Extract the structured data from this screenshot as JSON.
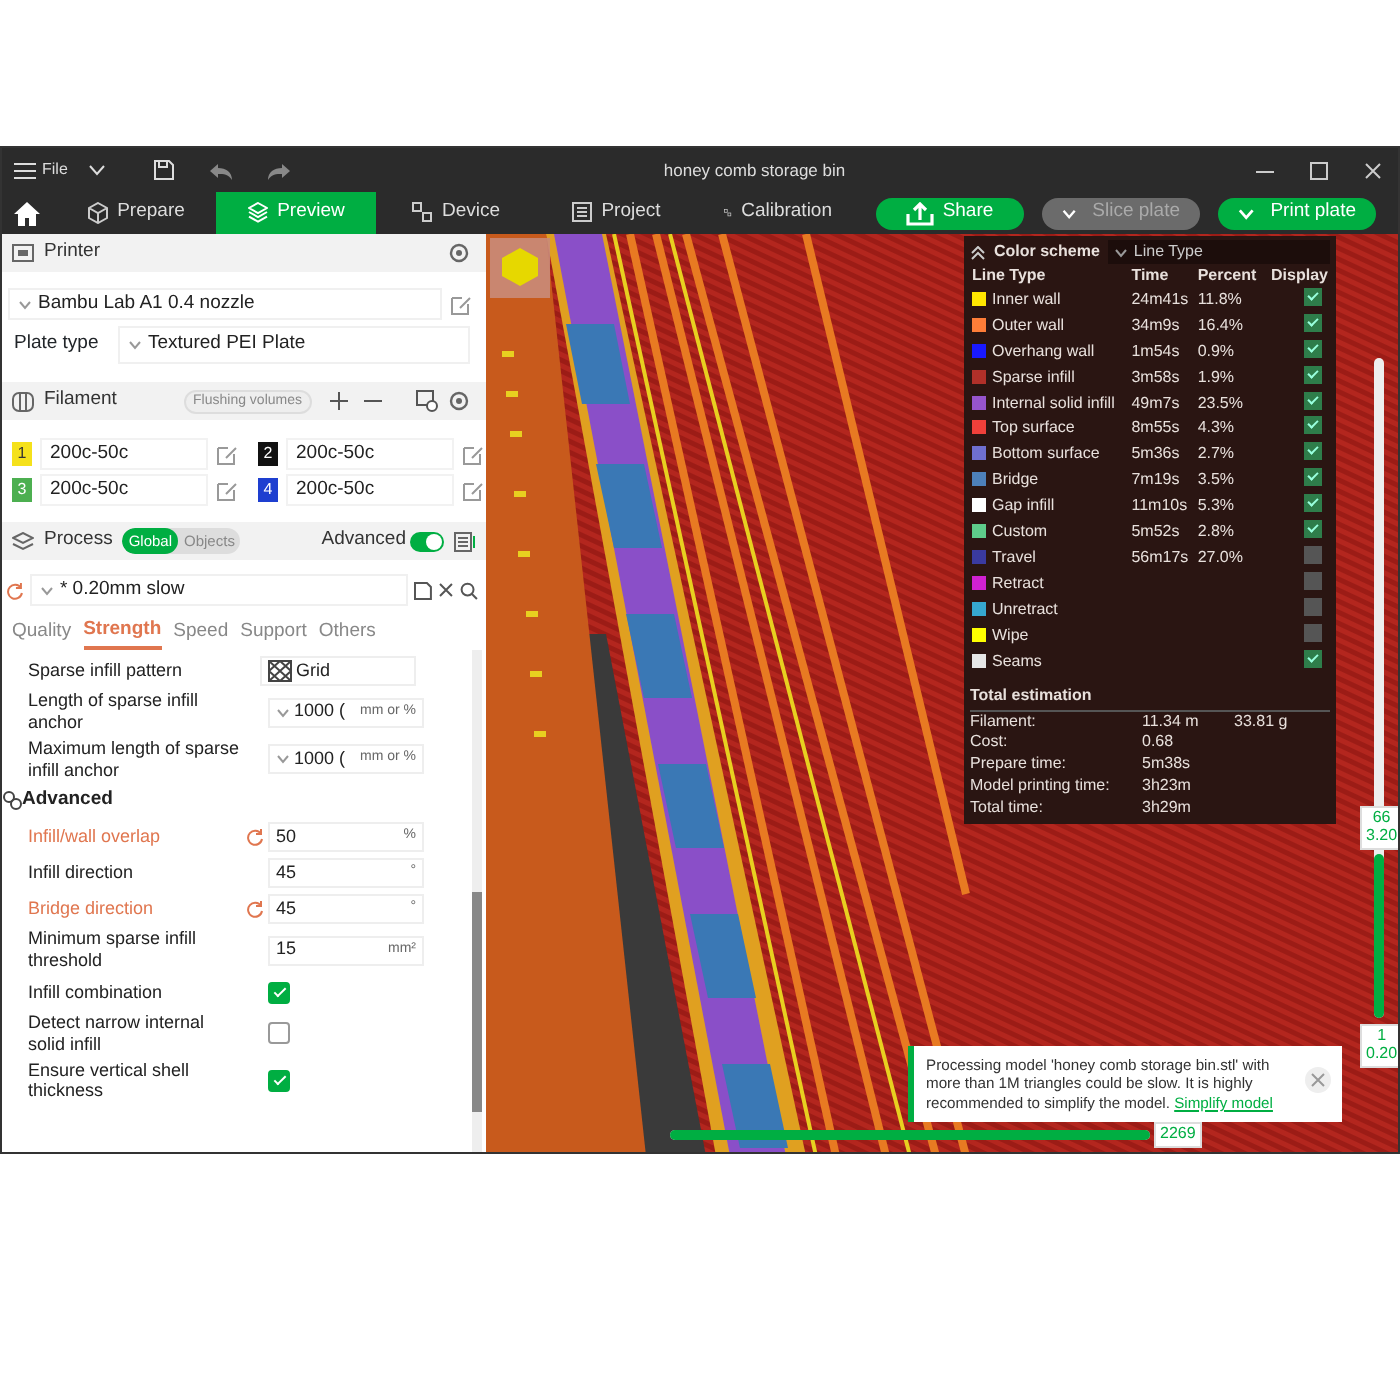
{
  "title_bar": {
    "menu": "File",
    "title": "honey comb storage bin"
  },
  "tabs": [
    {
      "label": "Prepare",
      "selected": false
    },
    {
      "label": "Preview",
      "selected": true
    },
    {
      "label": "Device",
      "selected": false
    },
    {
      "label": "Project",
      "selected": false
    },
    {
      "label": "Calibration",
      "selected": false
    }
  ],
  "actions": [
    {
      "label": "Share",
      "kind": "share",
      "disabled": false
    },
    {
      "label": "Slice plate",
      "kind": "split",
      "disabled": true
    },
    {
      "label": "Print plate",
      "kind": "split",
      "disabled": false
    }
  ],
  "printer": {
    "header": "Printer",
    "preset": "Bambu Lab A1 0.4 nozzle",
    "plate_type_label": "Plate type",
    "plate_type": "Textured PEI Plate"
  },
  "filament": {
    "header": "Filament",
    "flushing": "Flushing volumes",
    "slots": [
      {
        "number": "1",
        "color": "#f5e11b",
        "name": "200c-50c"
      },
      {
        "number": "2",
        "color": "#111111",
        "name": "200c-50c"
      },
      {
        "number": "3",
        "color": "#4caf50",
        "name": "200c-50c"
      },
      {
        "number": "4",
        "color": "#1e3fd0",
        "name": "200c-50c"
      }
    ]
  },
  "process": {
    "header": "Process",
    "scope": [
      {
        "label": "Global",
        "selected": true
      },
      {
        "label": "Objects",
        "selected": false
      }
    ],
    "advanced_label": "Advanced",
    "advanced_on": true,
    "preset": "* 0.20mm slow",
    "tabs": [
      {
        "label": "Quality",
        "selected": false
      },
      {
        "label": "Strength",
        "selected": true
      },
      {
        "label": "Speed",
        "selected": false
      },
      {
        "label": "Support",
        "selected": false
      },
      {
        "label": "Others",
        "selected": false
      }
    ],
    "settings": [
      {
        "kind": "pattern",
        "label": "Sparse infill pattern",
        "value": "Grid"
      },
      {
        "kind": "select",
        "label": "Length of sparse infill anchor",
        "value": "1000 (",
        "unit": "mm or %"
      },
      {
        "kind": "select",
        "label": "Maximum length of sparse infill anchor",
        "value": "1000 (",
        "unit": "mm or %"
      },
      {
        "kind": "section",
        "label": "Advanced"
      },
      {
        "kind": "input",
        "label": "Infill/wall overlap",
        "value": "50",
        "unit": "%",
        "modified": true
      },
      {
        "kind": "input",
        "label": "Infill direction",
        "value": "45",
        "unit": "°",
        "modified": false
      },
      {
        "kind": "input",
        "label": "Bridge direction",
        "value": "45",
        "unit": "°",
        "modified": true
      },
      {
        "kind": "input",
        "label": "Minimum sparse infill threshold",
        "value": "15",
        "unit": "mm²",
        "modified": false
      },
      {
        "kind": "checkbox",
        "label": "Infill combination",
        "checked": true
      },
      {
        "kind": "checkbox",
        "label": "Detect narrow internal solid infill",
        "checked": false
      },
      {
        "kind": "checkbox",
        "label": "Ensure vertical shell thickness",
        "checked": true
      }
    ]
  },
  "legend": {
    "title": "Color scheme",
    "scheme": "Line Type",
    "columns": [
      "Line Type",
      "Time",
      "Percent",
      "Display"
    ],
    "rows": [
      {
        "name": "Inner wall",
        "color": "#ffe600",
        "time": "24m41s",
        "percent": "11.8%",
        "display": true
      },
      {
        "name": "Outer wall",
        "color": "#ff7d38",
        "time": "34m9s",
        "percent": "16.4%",
        "display": true
      },
      {
        "name": "Overhang wall",
        "color": "#1919ff",
        "time": "1m54s",
        "percent": "0.9%",
        "display": true
      },
      {
        "name": "Sparse infill",
        "color": "#b03029",
        "time": "3m58s",
        "percent": "1.9%",
        "display": true
      },
      {
        "name": "Internal solid infill",
        "color": "#9654cc",
        "time": "49m7s",
        "percent": "23.5%",
        "display": true
      },
      {
        "name": "Top surface",
        "color": "#f0403a",
        "time": "8m55s",
        "percent": "4.3%",
        "display": true
      },
      {
        "name": "Bottom surface",
        "color": "#6f6fd0",
        "time": "5m36s",
        "percent": "2.7%",
        "display": true
      },
      {
        "name": "Bridge",
        "color": "#4d80ba",
        "time": "7m19s",
        "percent": "3.5%",
        "display": true
      },
      {
        "name": "Gap infill",
        "color": "#ffffff",
        "time": "11m10s",
        "percent": "5.3%",
        "display": true
      },
      {
        "name": "Custom",
        "color": "#5ecc8a",
        "time": "5m52s",
        "percent": "2.8%",
        "display": true
      },
      {
        "name": "Travel",
        "color": "#3a3aa0",
        "time": "56m17s",
        "percent": "27.0%",
        "display": false
      },
      {
        "name": "Retract",
        "color": "#d121d1",
        "display": false
      },
      {
        "name": "Unretract",
        "color": "#36a8d0",
        "display": false
      },
      {
        "name": "Wipe",
        "color": "#ffff00",
        "display": false
      },
      {
        "name": "Seams",
        "color": "#e6e6e6",
        "display": true
      }
    ],
    "total_title": "Total estimation",
    "totals": [
      {
        "label": "Filament:",
        "value": "11.34 m",
        "value_2": "33.81 g"
      },
      {
        "label": "Cost:",
        "value": "0.68"
      },
      {
        "label": "Prepare time:",
        "value": "5m38s"
      },
      {
        "label": "Model printing time:",
        "value": "3h23m"
      },
      {
        "label": "Total time:",
        "value": "3h29m"
      }
    ]
  },
  "layer_slider": {
    "upper": [
      "66",
      "3.20"
    ],
    "lower": [
      "1",
      "0.20"
    ],
    "level": 0.25
  },
  "move_slider": {
    "label": "2269",
    "level": 1
  },
  "notification": {
    "text": "Processing model 'honey comb storage bin.stl' with more than 1M triangles could be slow. It is highly recommended to simplify the model.",
    "link": "Simplify model"
  }
}
